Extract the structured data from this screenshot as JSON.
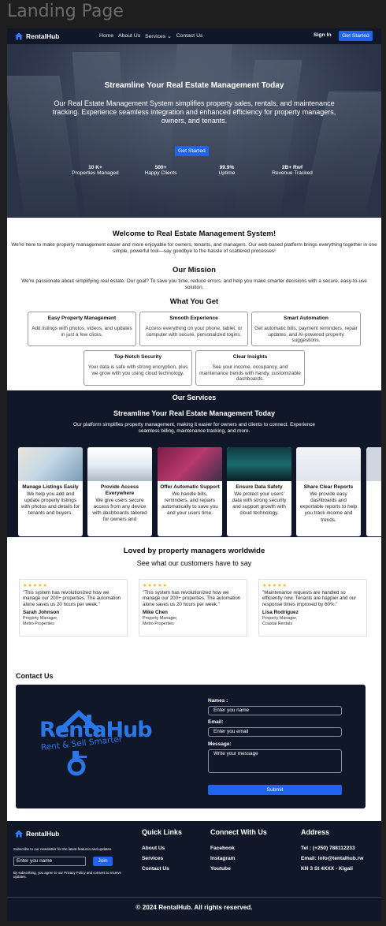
{
  "frame_title": "Landing Page",
  "nav": {
    "brand": "RentalHub",
    "links": [
      "Home",
      "About Us",
      "Services ⌄",
      "Contact Us"
    ],
    "signin": "Sign In",
    "get_started": "Get Started"
  },
  "hero": {
    "title": "Streamline Your Real Estate Management Today",
    "subtitle": "Our Real Estate Management System simplifies property sales, rentals, and maintenance tracking. Experience seamless integration and enhanced efficiency for property managers, owners, and tenants.",
    "button": "Get Started",
    "stats": [
      {
        "value": "10 K+",
        "label": "Properties Managed"
      },
      {
        "value": "500+",
        "label": "Happy Clients"
      },
      {
        "value": "99.9%",
        "label": "Uptime"
      },
      {
        "value": "2B+ Rwf",
        "label": "Revenue Tracked"
      }
    ]
  },
  "intro": {
    "welcome_title": "Welcome to Real Estate Management System!",
    "welcome_text": "We're here to make property management easier and more enjoyable for owners, tenants, and managers. Our web-based platform brings everything together in one simple, powerful tool—say goodbye to the hassle of scattered processes!",
    "mission_title": "Our Mission",
    "mission_text": "We're passionate about simplifying real estate. Our goal? To save you time, reduce errors, and help you make smarter decisions with a secure, easy-to-use solution.",
    "get_title": "What You Get",
    "cards": [
      {
        "title": "Easy Property Management",
        "text": "Add listings with photos, videos, and updates in just a few clicks."
      },
      {
        "title": "Smooth Experience",
        "text": "Access everything on your phone, tablet, or computer with secure, personalized logins."
      },
      {
        "title": "Smart Automation",
        "text": "Get automatic bills, payment reminders, repair updates, and AI-powered property suggestions."
      },
      {
        "title": "Top-Notch Security",
        "text": "Your data is safe with strong encryption, plus we grow with you using cloud technology."
      },
      {
        "title": "Clear Insights",
        "text": "See your income, occupancy, and maintenance trends with handy, customizable dashboards."
      }
    ]
  },
  "services": {
    "heading": "Our Services",
    "title": "Streamline Your Real Estate Management Today",
    "text": "Our platform simplifies property management, making it easier for owners and clients to connect. Experience seamless billing, maintenance tracking, and more.",
    "items": [
      {
        "title": "Manage Listings Easily",
        "text": "We help you add and update property listings with photos and details for tenants and buyers."
      },
      {
        "title": "Provide Access Everywhere",
        "text": "We give users secure access from any device with dashboards tailored for owners and"
      },
      {
        "title": "Offer Automatic Support",
        "text": "We handle bills, reminders, and repairs automatically to save you and your users time."
      },
      {
        "title": "Ensure Data Safety",
        "text": "We protect your users' data with strong security and support growth with cloud technology."
      },
      {
        "title": "Share Clear Reports",
        "text": "We provide easy dashboards and exportable reports to help you track income and trends."
      }
    ]
  },
  "testimonials": {
    "title": "Loved by property managers worldwide",
    "subtitle": "See what our customers have to say",
    "stars": "★★★★★",
    "items": [
      {
        "quote": "\"This system has revolutionized how we manage our 200+ properties. The automation alone saves us 20 hours per week.\"",
        "name": "Sarah Johnson",
        "role": "Property Manager,",
        "company": "Metro Properties"
      },
      {
        "quote": "\"This system has revolutionized how we manage our 200+ properties. The automation alone saves us 20 hours per week.\"",
        "name": "Mike Chen",
        "role": "Property Manager,",
        "company": "Metro Properties"
      },
      {
        "quote": "\"Maintenance requests are handled so efficiently now. Tenants are happier and our response times improved by 60%.\"",
        "name": "Lisa Rodriguez",
        "role": "Property Manager,",
        "company": "Coastal Rentals"
      }
    ]
  },
  "contact": {
    "title": "Contact Us",
    "logo_name": "RentaHub",
    "logo_tagline": "Rent & Sell Smarter",
    "name_label": "Names :",
    "name_placeholder": "Enter you name",
    "email_label": "Email:",
    "email_placeholder": "Enter you email",
    "message_label": "Message:",
    "message_placeholder": "Write your message",
    "submit": "Submit"
  },
  "footer": {
    "brand": "RentalHub",
    "newsletter": "Subscribe to our newsletter for the latest features and updates.",
    "input_placeholder": "Enter you name",
    "join": "Join",
    "consent": "By subscribing, you agree to our Privacy Policy and consent to receive updates.",
    "quick_title": "Quick Links",
    "quick_links": [
      "About Us",
      "Services",
      "Contact Us"
    ],
    "connect_title": "Connect With Us",
    "connect_links": [
      "Facebook",
      "Instagram",
      "Youtube"
    ],
    "address_title": "Address",
    "address_lines": [
      "Tel : (+250) 788112233",
      "Email: info@tentalhub.rw",
      "KN 3 St 4XXX - Kigali"
    ],
    "copyright": "© 2024 RentalHub. All rights reserved."
  },
  "colors": {
    "navy": "#0f1729",
    "accent": "#1f63ef",
    "star": "#f5b50a"
  }
}
